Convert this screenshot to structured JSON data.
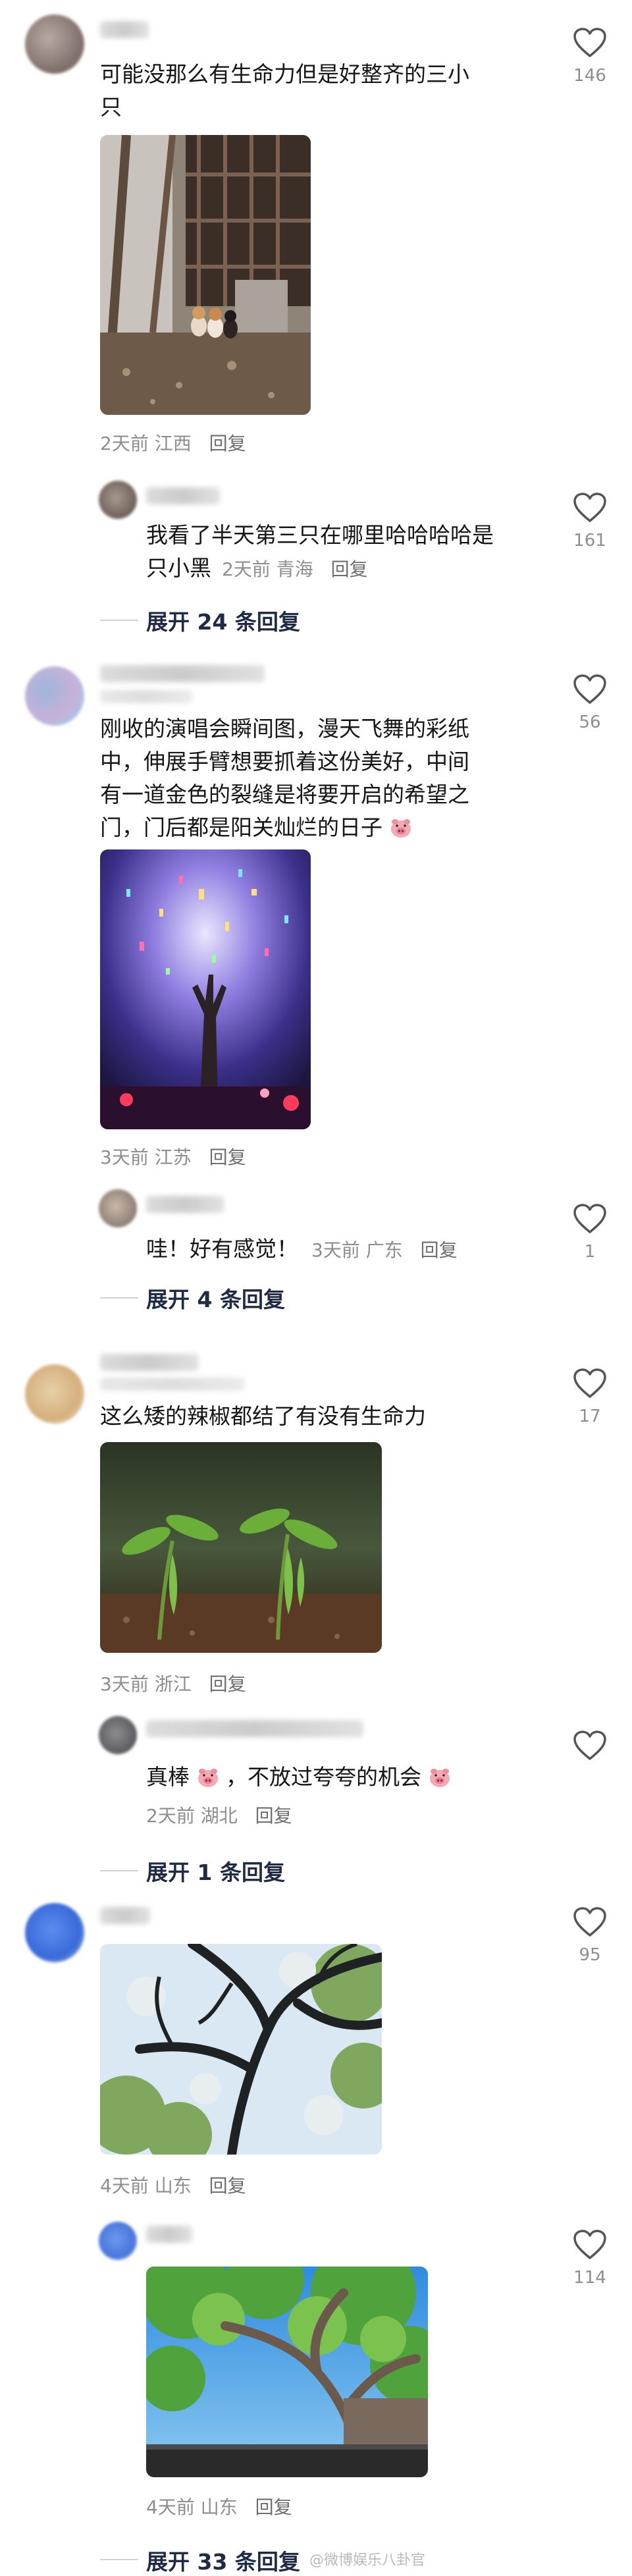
{
  "comments": [
    {
      "text_lines": [
        "可能没那么有生命力但是好整齐的三小",
        "只"
      ],
      "meta_time": "2天前",
      "meta_region": "江西",
      "reply_label": "回复",
      "likes": "146",
      "sub_reply": {
        "text_lines": [
          "我看了半天第三只在哪里哈哈哈哈是",
          "只小黑"
        ],
        "meta_time": "2天前",
        "meta_region": "青海",
        "reply_label": "回复",
        "likes": "161"
      },
      "expand_label": "展开 24 条回复"
    },
    {
      "text_lines": [
        "刚收的演唱会瞬间图，漫天飞舞的彩纸",
        "中，伸展手臂想要抓着这份美好，中间",
        "有一道金色的裂缝是将要开启的希望之",
        "门，门后都是阳关灿烂的日子"
      ],
      "meta_time": "3天前",
      "meta_region": "江苏",
      "reply_label": "回复",
      "likes": "56",
      "sub_reply": {
        "text_lines": [
          "哇！好有感觉！"
        ],
        "meta_time": "3天前",
        "meta_region": "广东",
        "reply_label": "回复",
        "likes": "1"
      },
      "expand_label": "展开 4 条回复"
    },
    {
      "text_lines": [
        "这么矮的辣椒都结了有没有生命力"
      ],
      "meta_time": "3天前",
      "meta_region": "浙江",
      "reply_label": "回复",
      "likes": "17",
      "sub_reply": {
        "text_lines": [
          "真棒",
          "，不放过夸夸的机会"
        ],
        "meta_time": "2天前",
        "meta_region": "湖北",
        "reply_label": "回复",
        "likes": ""
      },
      "expand_label": "展开 1 条回复"
    },
    {
      "text_lines": [],
      "meta_time": "4天前",
      "meta_region": "山东",
      "reply_label": "回复",
      "likes": "95"
    },
    {
      "text_lines": [],
      "meta_time": "4天前",
      "meta_region": "山东",
      "reply_label": "回复",
      "likes": "114",
      "expand_label": "展开 33 条回复"
    }
  ],
  "watermark": "@微博娱乐八卦官",
  "icons": {
    "like": "heart-outline-icon",
    "emoji_pig": "pig-face-emoji-icon"
  },
  "colors": {
    "text": "#161616",
    "meta": "#8e8e8e",
    "expand": "#1f2a44"
  }
}
